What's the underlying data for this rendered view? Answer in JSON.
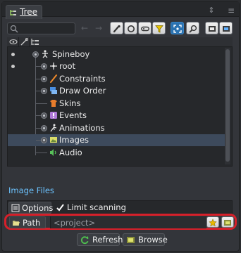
{
  "tab": {
    "label": "Tree",
    "resize_glyph": "⇕",
    "menu_glyph": "≡",
    "icon": "tree-icon"
  },
  "toolbar": {
    "search_placeholder": "",
    "search_icon": "search-icon",
    "back_glyph": "←",
    "forward_glyph": "→",
    "buttons": [
      "bones-filter",
      "slots-filter",
      "attachments-filter",
      "constraints-filter",
      "sync-selection",
      "find",
      "cut",
      "paste"
    ]
  },
  "tree": {
    "columns": [
      "visibility-icon",
      "keys-icon",
      "hierarchy-icon"
    ],
    "items": [
      {
        "label": "Spineboy",
        "icon": "skeleton-icon",
        "depth": 0,
        "visible": true,
        "selected": false
      },
      {
        "label": "root",
        "icon": "bone-icon",
        "depth": 1,
        "visible": true,
        "selected": false
      },
      {
        "label": "Constraints",
        "icon": "constraints-icon",
        "depth": 1,
        "visible": false,
        "selected": false
      },
      {
        "label": "Draw Order",
        "icon": "draw-order-icon",
        "depth": 1,
        "visible": false,
        "selected": false
      },
      {
        "label": "Skins",
        "icon": "skins-icon",
        "depth": 1,
        "visible": false,
        "selected": false
      },
      {
        "label": "Events",
        "icon": "events-icon",
        "depth": 1,
        "visible": false,
        "selected": false
      },
      {
        "label": "Animations",
        "icon": "animations-icon",
        "depth": 1,
        "visible": false,
        "selected": false
      },
      {
        "label": "Images",
        "icon": "images-icon",
        "depth": 1,
        "visible": false,
        "selected": true
      },
      {
        "label": "Audio",
        "icon": "audio-icon",
        "depth": 1,
        "visible": false,
        "selected": false
      }
    ]
  },
  "image_files": {
    "title": "Image Files",
    "options_label": "Options",
    "limit_scanning_label": "Limit scanning",
    "limit_scanning_checked": true,
    "path_label": "Path",
    "path_value": "<project>",
    "refresh_label": "Refresh",
    "browse_label": "Browse"
  },
  "colors": {
    "accent": "#6cc3ff",
    "highlight": "#d6202a",
    "selection": "#3d4a5c"
  }
}
